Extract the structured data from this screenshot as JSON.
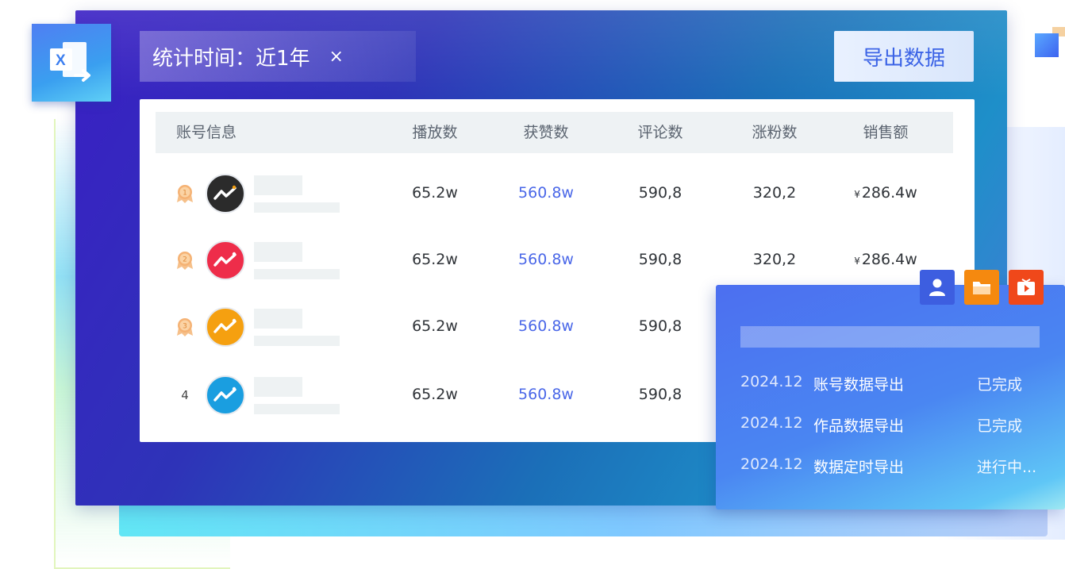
{
  "filter": {
    "label": "统计时间：近1年",
    "close": "×"
  },
  "toolbar": {
    "export_label": "导出数据"
  },
  "table": {
    "headers": {
      "account": "账号信息",
      "plays": "播放数",
      "likes": "获赞数",
      "comments": "评论数",
      "followers": "涨粉数",
      "sales": "销售额"
    },
    "rows": [
      {
        "rank": "1",
        "plays": "65.2w",
        "likes": "560.8w",
        "comments": "590,8",
        "followers": "320,2",
        "currency": "¥",
        "sales": "286.4w",
        "avatar_color": "#2b2b2b",
        "rank_style": "medal"
      },
      {
        "rank": "2",
        "plays": "65.2w",
        "likes": "560.8w",
        "comments": "590,8",
        "followers": "320,2",
        "currency": "¥",
        "sales": "286.4w",
        "avatar_color": "#ee2d4a",
        "rank_style": "medal"
      },
      {
        "rank": "3",
        "plays": "65.2w",
        "likes": "560.8w",
        "comments": "590,8",
        "followers": "",
        "currency": "",
        "sales": "",
        "avatar_color": "#f5a010",
        "rank_style": "medal"
      },
      {
        "rank": "4",
        "plays": "65.2w",
        "likes": "560.8w",
        "comments": "590,8",
        "followers": "",
        "currency": "",
        "sales": "",
        "avatar_color": "#1a9ee0",
        "rank_style": "plain"
      }
    ]
  },
  "export_panel": {
    "tiles": [
      {
        "icon": "user-icon",
        "color": "#3d5ee0"
      },
      {
        "icon": "folder-icon",
        "color": "#f5890f"
      },
      {
        "icon": "video-icon",
        "color": "#f0481a"
      }
    ],
    "tasks": [
      {
        "date": "2024.12",
        "name": "账号数据导出",
        "status": "已完成"
      },
      {
        "date": "2024.12",
        "name": "作品数据导出",
        "status": "已完成"
      },
      {
        "date": "2024.12",
        "name": "数据定时导出",
        "status": "进行中..."
      }
    ]
  }
}
